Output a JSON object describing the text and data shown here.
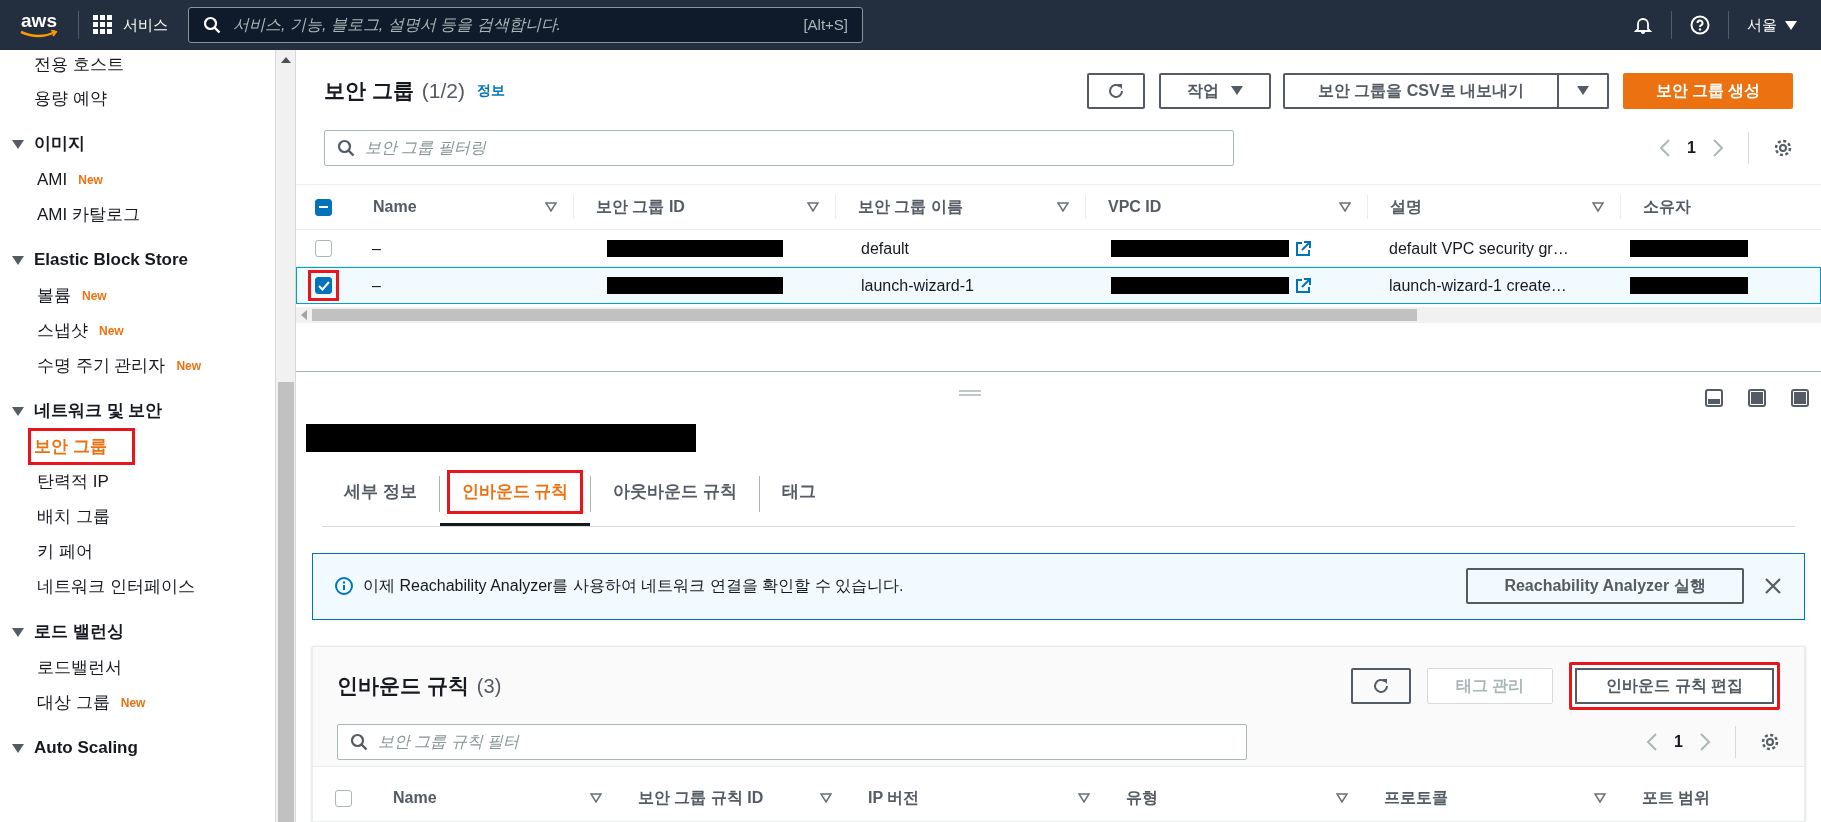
{
  "top_nav": {
    "logo": "aws",
    "services": "서비스",
    "search_placeholder": "서비스, 기능, 블로그, 설명서 등을 검색합니다.",
    "shortcut": "[Alt+S]",
    "region": "서울"
  },
  "sidebar": {
    "items": [
      {
        "kind": "item",
        "label": "전용 호스트",
        "selected": false,
        "highlighted": false
      },
      {
        "kind": "item",
        "label": "용량 예약",
        "selected": false,
        "highlighted": false
      },
      {
        "kind": "section",
        "label": "이미지",
        "expanded": true,
        "children": [
          {
            "label": "AMI",
            "badge": "New",
            "selected": false,
            "highlighted": false
          },
          {
            "label": "AMI 카탈로그",
            "selected": false,
            "highlighted": false
          }
        ]
      },
      {
        "kind": "section",
        "label": "Elastic Block Store",
        "expanded": true,
        "children": [
          {
            "label": "볼륨",
            "badge": "New",
            "selected": false,
            "highlighted": false
          },
          {
            "label": "스냅샷",
            "badge": "New",
            "selected": false,
            "highlighted": false
          },
          {
            "label": "수명 주기 관리자",
            "badge": "New",
            "selected": false,
            "highlighted": false
          }
        ]
      },
      {
        "kind": "section",
        "label": "네트워크 및 보안",
        "expanded": true,
        "children": [
          {
            "label": "보안 그룹",
            "selected": true,
            "highlighted": true
          },
          {
            "label": "탄력적 IP",
            "selected": false,
            "highlighted": false
          },
          {
            "label": "배치 그룹",
            "selected": false,
            "highlighted": false
          },
          {
            "label": "키 페어",
            "selected": false,
            "highlighted": false
          },
          {
            "label": "네트워크 인터페이스",
            "selected": false,
            "highlighted": false
          }
        ]
      },
      {
        "kind": "section",
        "label": "로드 밸런싱",
        "expanded": true,
        "children": [
          {
            "label": "로드밸런서",
            "selected": false,
            "highlighted": false
          },
          {
            "label": "대상 그룹",
            "badge": "New",
            "selected": false,
            "highlighted": false
          }
        ]
      },
      {
        "kind": "section",
        "label": "Auto Scaling",
        "expanded": true
      }
    ]
  },
  "security_groups": {
    "title": "보안 그룹",
    "count": "(1/2)",
    "info": "정보",
    "actions": "작업",
    "export": "보안 그룹을 CSV로 내보내기",
    "create": "보안 그룹 생성",
    "filter_placeholder": "보안 그룹 필터링",
    "page": "1",
    "header_indeterminate": true,
    "columns": [
      "Name",
      "보안 그룹 ID",
      "보안 그룹 이름",
      "VPC ID",
      "설명",
      "소유자"
    ],
    "rows": [
      {
        "checked": false,
        "selected": false,
        "highlighted": false,
        "name": "–",
        "group_name": "default",
        "description": "default VPC security gr…"
      },
      {
        "checked": true,
        "selected": true,
        "highlighted": true,
        "name": "–",
        "group_name": "launch-wizard-1",
        "description": "launch-wizard-1 create…"
      }
    ]
  },
  "details": {
    "tabs": [
      {
        "label": "세부 정보",
        "selected": false,
        "highlighted": false
      },
      {
        "label": "인바운드 규칙",
        "selected": true,
        "highlighted": true
      },
      {
        "label": "아웃바운드 규칙",
        "selected": false,
        "highlighted": false
      },
      {
        "label": "태그",
        "selected": false,
        "highlighted": false
      }
    ],
    "banner": {
      "text": "이제 Reachability Analyzer를 사용하여 네트워크 연결을 확인할 수 있습니다.",
      "button": "Reachability Analyzer 실행"
    },
    "inbound": {
      "title": "인바운드 규칙",
      "count": "(3)",
      "buttons": [
        {
          "label": "태그 관리",
          "disabled": true,
          "highlighted": false
        },
        {
          "label": "인바운드 규칙 편집",
          "disabled": false,
          "highlighted": true
        }
      ],
      "filter_placeholder": "보안 그룹 규칙 필터",
      "page": "1",
      "header_checked": false,
      "columns": [
        "Name",
        "보안 그룹 규칙 ID",
        "IP 버전",
        "유형",
        "프로토콜",
        "포트 범위"
      ]
    }
  }
}
